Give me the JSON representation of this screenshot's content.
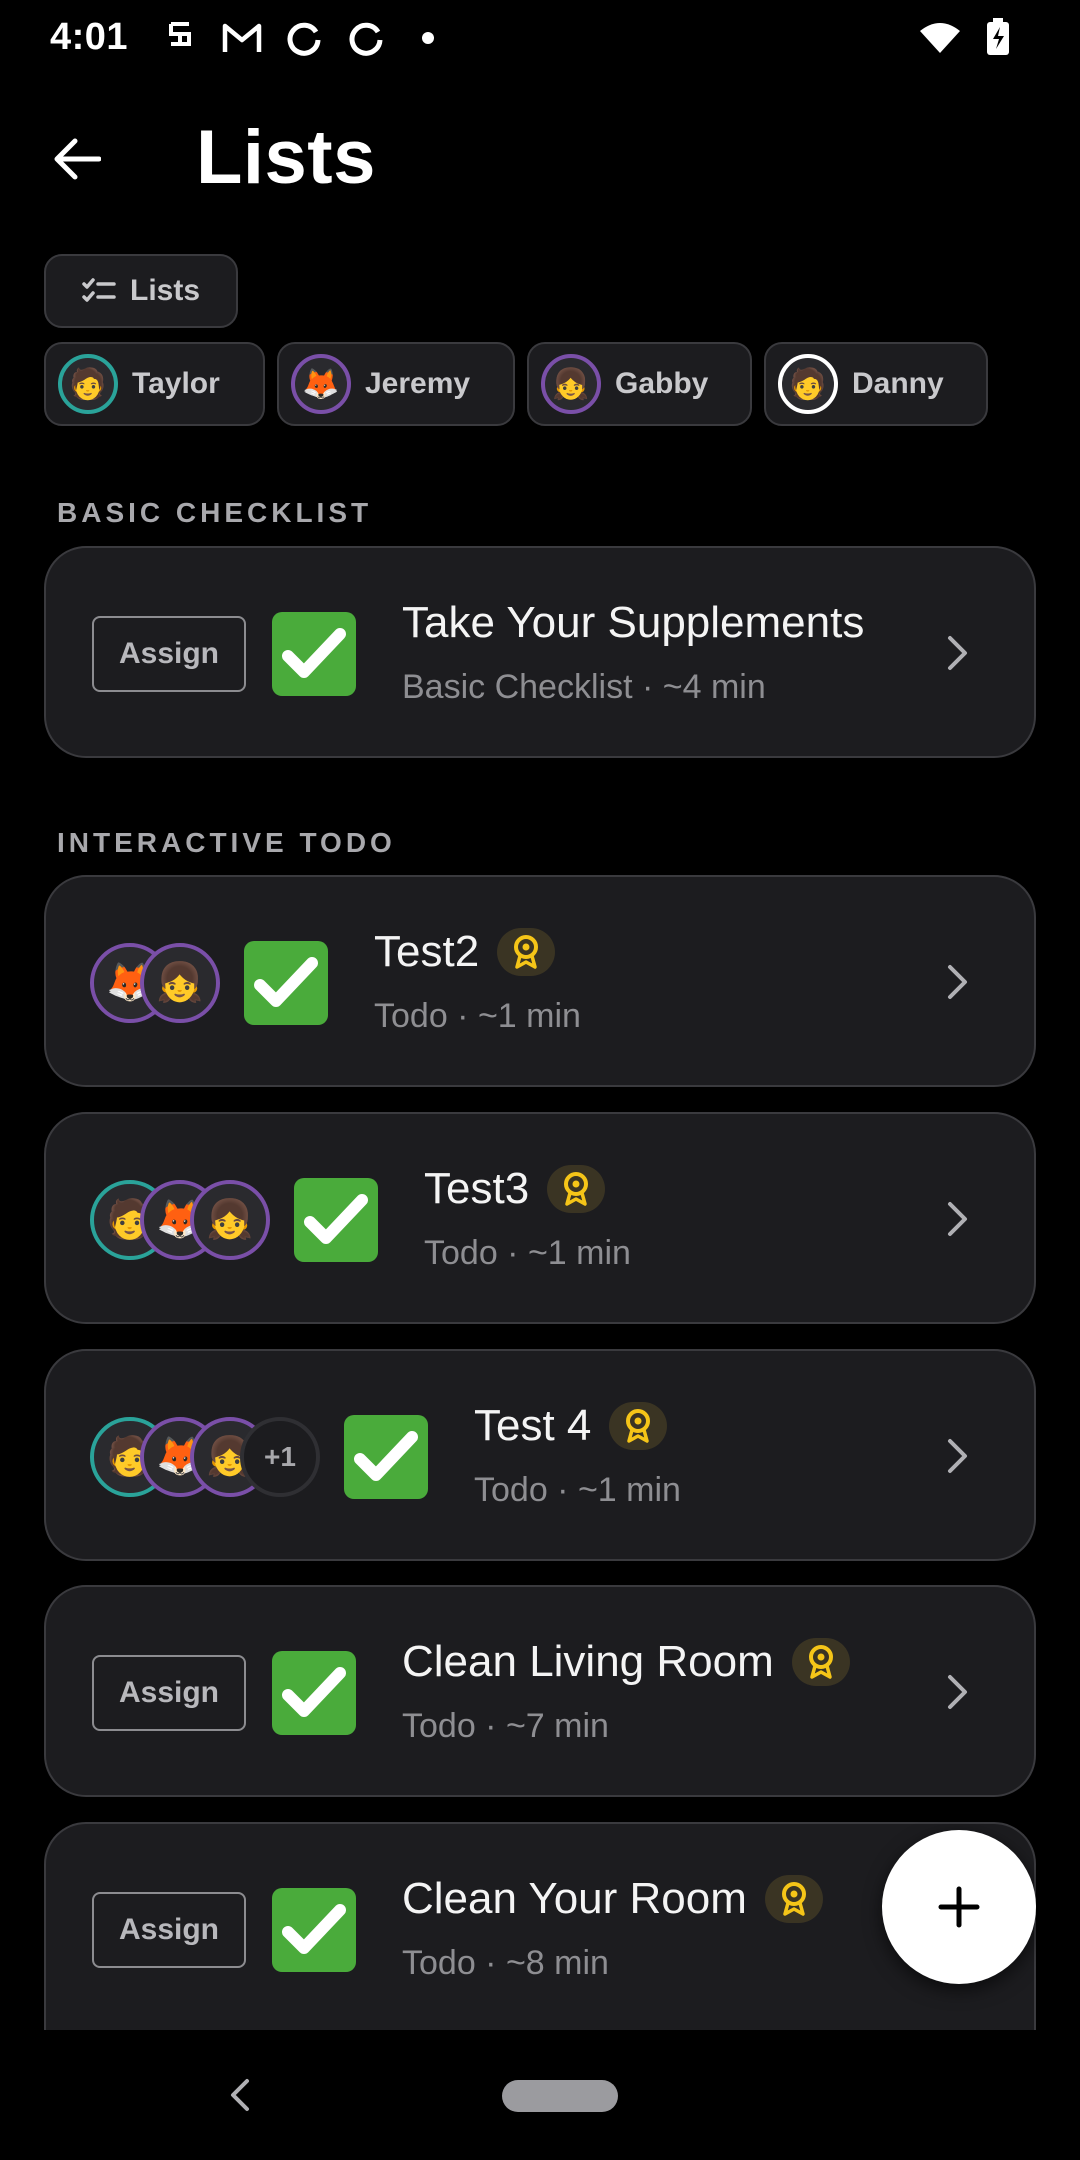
{
  "status_bar": {
    "time": "4:01",
    "left_icons": [
      "notification-app-icon",
      "gmail-icon",
      "sync-icon",
      "sync-icon",
      "dot-icon"
    ],
    "right_icons": [
      "wifi-icon",
      "battery-charging-icon"
    ]
  },
  "header": {
    "title": "Lists",
    "back_icon": "arrow-left-icon"
  },
  "filters": {
    "lists_chip": "Lists",
    "people": [
      {
        "name": "Taylor",
        "emoji": "🧑",
        "ring": "#2aa39a"
      },
      {
        "name": "Jeremy",
        "emoji": "🦊",
        "ring": "#7a4fa8"
      },
      {
        "name": "Gabby",
        "emoji": "👧",
        "ring": "#7a4fa8"
      },
      {
        "name": "Danny",
        "emoji": "🧑",
        "ring": "#ffffff"
      }
    ]
  },
  "sections": {
    "basic_label": "BASIC CHECKLIST",
    "interactive_label": "INTERACTIVE TODO"
  },
  "cards": [
    {
      "title": "Take Your Supplements",
      "subtitle": "Basic Checklist · ~4 min",
      "assign_label": "Assign",
      "badge": false
    },
    {
      "title": "Test2",
      "subtitle": "Todo · ~1 min",
      "badge": true,
      "assignees": [
        "🦊",
        "👧"
      ]
    },
    {
      "title": "Test3",
      "subtitle": "Todo · ~1 min",
      "badge": true,
      "assignees": [
        "🧑",
        "🦊",
        "👧"
      ]
    },
    {
      "title": "Test 4",
      "subtitle": "Todo · ~1 min",
      "badge": true,
      "assignees": [
        "🧑",
        "🦊",
        "👧"
      ],
      "more": "+1"
    },
    {
      "title": "Clean Living Room",
      "subtitle": "Todo · ~7 min",
      "assign_label": "Assign",
      "badge": true
    },
    {
      "title": "Clean Your Room",
      "subtitle": "Todo · ~8 min",
      "assign_label": "Assign",
      "badge": true
    }
  ],
  "fab": {
    "icon": "plus-icon"
  },
  "colors": {
    "background": "#000000",
    "card": "#1c1c1f",
    "check_green": "#4aab3b",
    "badge_gold": "#f5c518"
  }
}
